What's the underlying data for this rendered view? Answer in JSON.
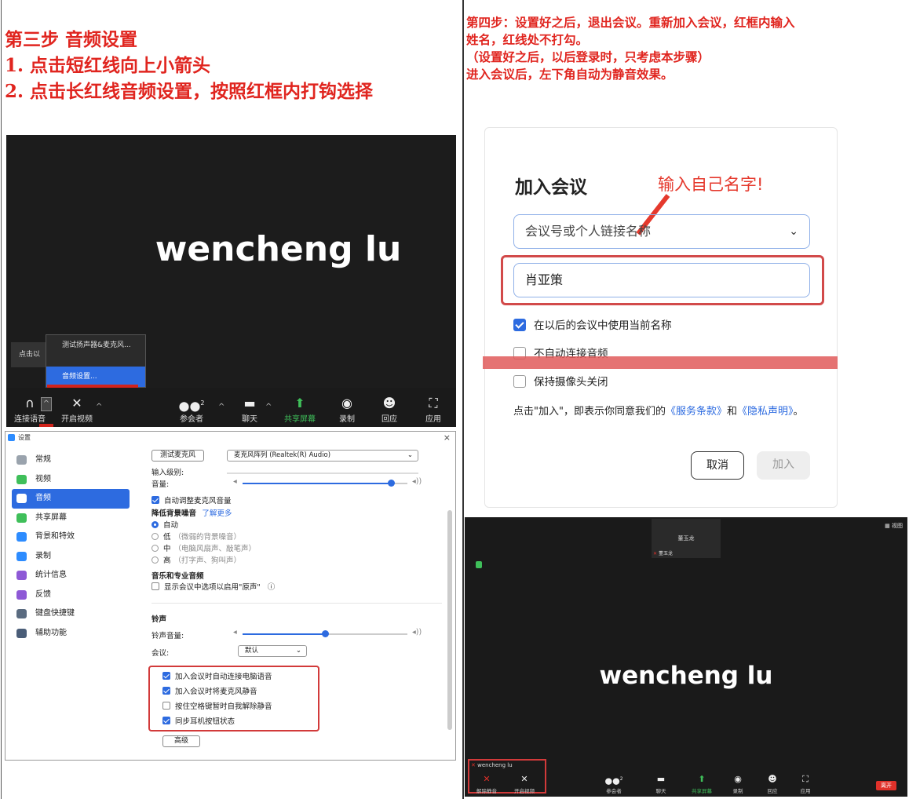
{
  "left": {
    "step3_title": "第三步 音频设置",
    "step3_line1": "1. 点击短红线向上小箭头",
    "step3_line2": "2. 点击长红线音频设置，按照红框内打钩选择"
  },
  "call1": {
    "participant_name": "wencheng lu",
    "tooltip": "点击以",
    "menu_item_test": "测试扬声器&麦克风...",
    "menu_item_audio_settings": "音频设置...",
    "toolbar": {
      "join_audio": "连接语音",
      "start_video": "开启视频",
      "participants": "参会者",
      "participants_count": "2",
      "chat": "聊天",
      "share": "共享屏幕",
      "record": "录制",
      "reactions": "回应",
      "apps": "应用"
    }
  },
  "settings": {
    "window_title": "设置",
    "close": "×",
    "nav": [
      "常规",
      "视频",
      "音频",
      "共享屏幕",
      "背景和特效",
      "录制",
      "统计信息",
      "反馈",
      "键盘快捷键",
      "辅助功能"
    ],
    "nav_icon_colors": [
      "#9aa3ad",
      "#3fbf5a",
      "#2d6be0",
      "#3fbf5a",
      "#2d8cff",
      "#2d8cff",
      "#8e59d6",
      "#8e59d6",
      "#5a6b80",
      "#4a5d78"
    ],
    "test_mic_button": "测试麦克风",
    "mic_select": "麦克风阵列 (Realtek(R) Audio)",
    "input_level_label": "输入级别:",
    "volume_label": "音量:",
    "mic_volume": 0.9,
    "auto_adjust": "自动调整麦克风音量",
    "noise_title": "降低背景噪音",
    "learn_more": "了解更多",
    "noise_options": [
      {
        "label": "自动",
        "hint": ""
      },
      {
        "label": "低",
        "hint": "（微弱的背景噪音）"
      },
      {
        "label": "中",
        "hint": "（电脑风扇声、敲笔声）"
      },
      {
        "label": "高",
        "hint": "（打字声、狗叫声）"
      }
    ],
    "music_title": "音乐和专业音频",
    "original_sound": "显示会议中选项以启用\"原声\"",
    "ringtone_title": "铃声",
    "ring_volume_label": "铃声音量:",
    "ring_volume": 0.5,
    "meeting_label": "会议:",
    "meeting_select": "默认",
    "options": [
      {
        "label": "加入会议时自动连接电脑语音",
        "checked": true
      },
      {
        "label": "加入会议时将麦克风静音",
        "checked": true
      },
      {
        "label": "按住空格键暂时自我解除静音",
        "checked": false
      },
      {
        "label": "同步耳机按钮状态",
        "checked": true
      }
    ],
    "advanced_button": "高级"
  },
  "right": {
    "step4_line1": "第四步：设置好之后，退出会议。重新加入会议，红框内输入",
    "step4_line2": "姓名，红线处不打勾。",
    "step4_line3": "（设置好之后，以后登录时，只考虑本步骤）",
    "step4_line4": "进入会议后，左下角自动为静音效果。"
  },
  "join": {
    "title": "加入会议",
    "annotation": "输入自己名字!",
    "meeting_id_placeholder": "会议号或个人链接名称",
    "name_value": "肖亚策",
    "options": [
      {
        "label": "在以后的会议中使用当前名称",
        "checked": true
      },
      {
        "label": "不自动连接音频",
        "checked": false
      },
      {
        "label": "保持摄像头关闭",
        "checked": false
      }
    ],
    "terms_prefix": "点击\"加入\"，即表示你同意我们的",
    "terms_service": "《服务条款》",
    "terms_and": "和",
    "terms_privacy": "《隐私声明》",
    "terms_suffix": "。",
    "cancel_button": "取消",
    "join_button": "加入"
  },
  "call2": {
    "participant_name": "wencheng lu",
    "thumb_name": "董玉龙",
    "thumb_label": "董玉龙",
    "view_label": "视图",
    "self_label": "wencheng lu",
    "toolbar": {
      "unmute": "解除静音",
      "start_video": "开启视频",
      "participants": "参会者",
      "participants_count": "2",
      "chat": "聊天",
      "share": "共享屏幕",
      "record": "录制",
      "reactions": "回应",
      "apps": "应用",
      "leave": "离开"
    }
  }
}
